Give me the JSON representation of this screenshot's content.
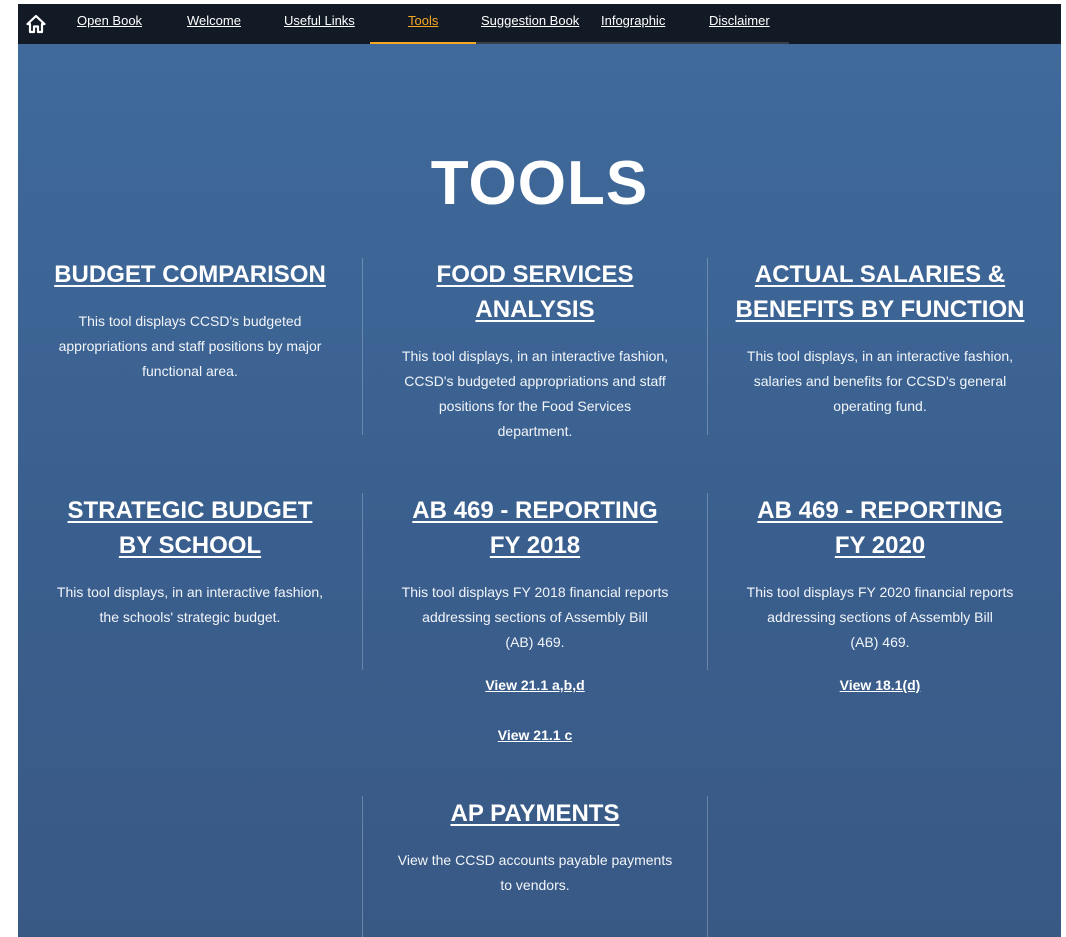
{
  "nav": {
    "items": [
      {
        "label": "Open Book"
      },
      {
        "label": "Welcome"
      },
      {
        "label": "Useful Links"
      },
      {
        "label": "Tools"
      },
      {
        "label": "Suggestion Book"
      },
      {
        "label": "Infographic"
      },
      {
        "label": "Disclaimer"
      }
    ],
    "active": "Tools",
    "accent_color": "#f5a623"
  },
  "page": {
    "title": "TOOLS"
  },
  "tools": [
    {
      "title_lines": [
        "BUDGET COMPARISON"
      ],
      "description_lines": [
        "This tool displays CCSD's budgeted",
        "appropriations and staff positions by major",
        "functional area."
      ]
    },
    {
      "title_lines": [
        "FOOD SERVICES",
        "ANALYSIS"
      ],
      "description_lines": [
        "This tool displays, in an interactive fashion,",
        "CCSD's budgeted appropriations and staff",
        "positions for the Food Services",
        "department."
      ]
    },
    {
      "title_lines": [
        "ACTUAL SALARIES &",
        "BENEFITS BY FUNCTION"
      ],
      "description_lines": [
        "This tool displays, in an interactive fashion,",
        "salaries and benefits for CCSD's general",
        "operating fund."
      ]
    },
    {
      "title_lines": [
        "STRATEGIC BUDGET",
        "BY SCHOOL"
      ],
      "description_lines": [
        "This tool displays, in an interactive fashion,",
        "the schools' strategic budget."
      ]
    },
    {
      "title_lines": [
        "AB 469 - REPORTING",
        "FY 2018"
      ],
      "description_lines": [
        "This tool displays FY 2018 financial reports",
        "addressing sections of Assembly Bill",
        "(AB) 469."
      ],
      "links": [
        "View 21.1 a,b,d",
        "View 21.1 c"
      ]
    },
    {
      "title_lines": [
        "AB 469 - REPORTING",
        "FY 2020"
      ],
      "description_lines": [
        "This tool displays FY 2020 financial reports",
        "addressing sections of Assembly Bill",
        "(AB) 469."
      ],
      "links": [
        "View 18.1(d)"
      ]
    },
    {
      "title_lines": [
        "AP PAYMENTS"
      ],
      "description_lines": [
        "View the CCSD accounts payable payments",
        "to vendors."
      ]
    }
  ]
}
